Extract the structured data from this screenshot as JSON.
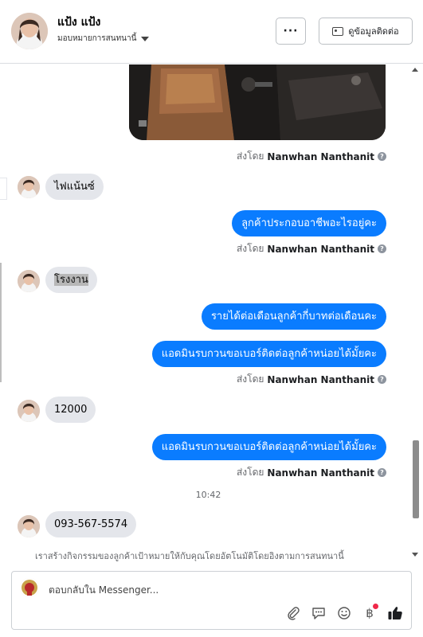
{
  "header": {
    "name": "แป้ง แป้ง",
    "assign": "มอบหมายการสนทนานี้",
    "more_label": "···",
    "contact_label": "ดูข้อมูลติดต่อ"
  },
  "sent_by": {
    "prefix": "ส่งโดย",
    "agent": "Nanwhan Nanthanit",
    "info": "?"
  },
  "messages": [
    {
      "dir": "in",
      "text": "ไฟแน้นซ์"
    },
    {
      "dir": "out",
      "text": "ลูกค้าประกอบอาชีพอะไรอยู่คะ"
    },
    {
      "dir": "in",
      "text": "โรงงาน"
    },
    {
      "dir": "out",
      "text": "รายได้ต่อเดือนลูกค้ากี่บาทต่อเดือนคะ"
    },
    {
      "dir": "out",
      "text": "แอดมินรบกวนขอเบอร์ติดต่อลูกค้าหน่อยได้มั้ยคะ"
    },
    {
      "dir": "in",
      "text": "12000"
    },
    {
      "dir": "out",
      "text": "แอดมินรบกวนขอเบอร์ติดต่อลูกค้าหน่อยได้มั้ยคะ"
    },
    {
      "dir": "in",
      "text": "093-567-5574"
    }
  ],
  "timestamp": "10:42",
  "notice": "เราสร้างกิจกรรมของลูกค้าเป้าหมายให้กับคุณโดยอัตโนมัติโดยอิงตามการสนทนานี้",
  "composer": {
    "placeholder": "ตอบกลับใน Messenger...",
    "icons": [
      "paperclip-icon",
      "saved-reply-icon",
      "emoji-icon",
      "baht-payment-icon",
      "thumbs-up-icon"
    ],
    "baht_symbol": "฿"
  },
  "colors": {
    "outgoing": "#0a7cff",
    "incoming": "#e4e6eb",
    "thumb": "#1c1e21"
  }
}
